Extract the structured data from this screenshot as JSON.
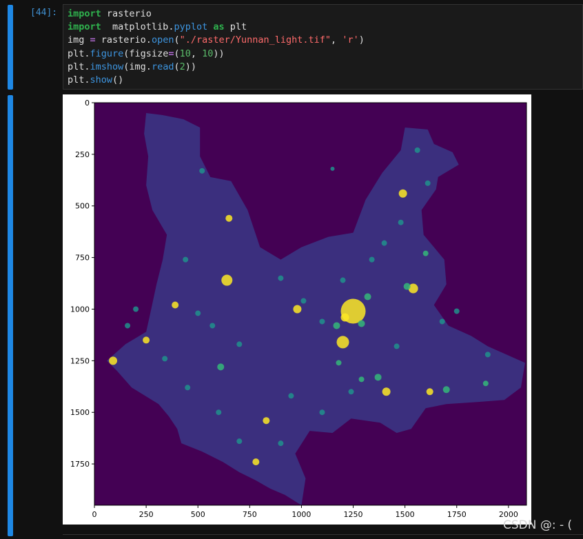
{
  "cell": {
    "prompt": "[44]:",
    "code": [
      [
        {
          "t": "import",
          "c": "kw"
        },
        {
          "t": " rasterio",
          "c": ""
        }
      ],
      [
        {
          "t": "import",
          "c": "kw"
        },
        {
          "t": "  matplotlib.",
          "c": ""
        },
        {
          "t": "pyplot",
          "c": "fn"
        },
        {
          "t": " ",
          "c": ""
        },
        {
          "t": "as",
          "c": "kw"
        },
        {
          "t": " plt",
          "c": ""
        }
      ],
      [
        {
          "t": "img ",
          "c": ""
        },
        {
          "t": "=",
          "c": "op"
        },
        {
          "t": " rasterio.",
          "c": ""
        },
        {
          "t": "open",
          "c": "fn"
        },
        {
          "t": "(",
          "c": ""
        },
        {
          "t": "\"./raster/Yunnan_light.tif\"",
          "c": "str"
        },
        {
          "t": ", ",
          "c": ""
        },
        {
          "t": "'r'",
          "c": "str"
        },
        {
          "t": ")",
          "c": ""
        }
      ],
      [
        {
          "t": "plt.",
          "c": ""
        },
        {
          "t": "figure",
          "c": "fn"
        },
        {
          "t": "(figsize",
          "c": ""
        },
        {
          "t": "=",
          "c": "op"
        },
        {
          "t": "(",
          "c": ""
        },
        {
          "t": "10",
          "c": "num"
        },
        {
          "t": ", ",
          "c": ""
        },
        {
          "t": "10",
          "c": "num"
        },
        {
          "t": "))",
          "c": ""
        }
      ],
      [
        {
          "t": "plt.",
          "c": ""
        },
        {
          "t": "imshow",
          "c": "fn"
        },
        {
          "t": "(img.",
          "c": ""
        },
        {
          "t": "read",
          "c": "fn"
        },
        {
          "t": "(",
          "c": ""
        },
        {
          "t": "2",
          "c": "num"
        },
        {
          "t": "))",
          "c": ""
        }
      ],
      [
        {
          "t": "plt.",
          "c": ""
        },
        {
          "t": "show",
          "c": "fn"
        },
        {
          "t": "()",
          "c": ""
        }
      ]
    ]
  },
  "plot": {
    "colors": {
      "background": "#440154",
      "land": "#3b2f7e",
      "bright": "#fde725",
      "mid": "#35b779",
      "teal": "#21918c"
    },
    "xticks": [
      "0",
      "250",
      "500",
      "750",
      "1000",
      "1250",
      "1500",
      "1750",
      "2000"
    ],
    "yticks": [
      "0",
      "250",
      "500",
      "750",
      "1000",
      "1250",
      "1500",
      "1750"
    ],
    "xlim": [
      0,
      2087
    ],
    "ylim": [
      0,
      1950
    ]
  },
  "watermark": "CSDN @: - ("
}
